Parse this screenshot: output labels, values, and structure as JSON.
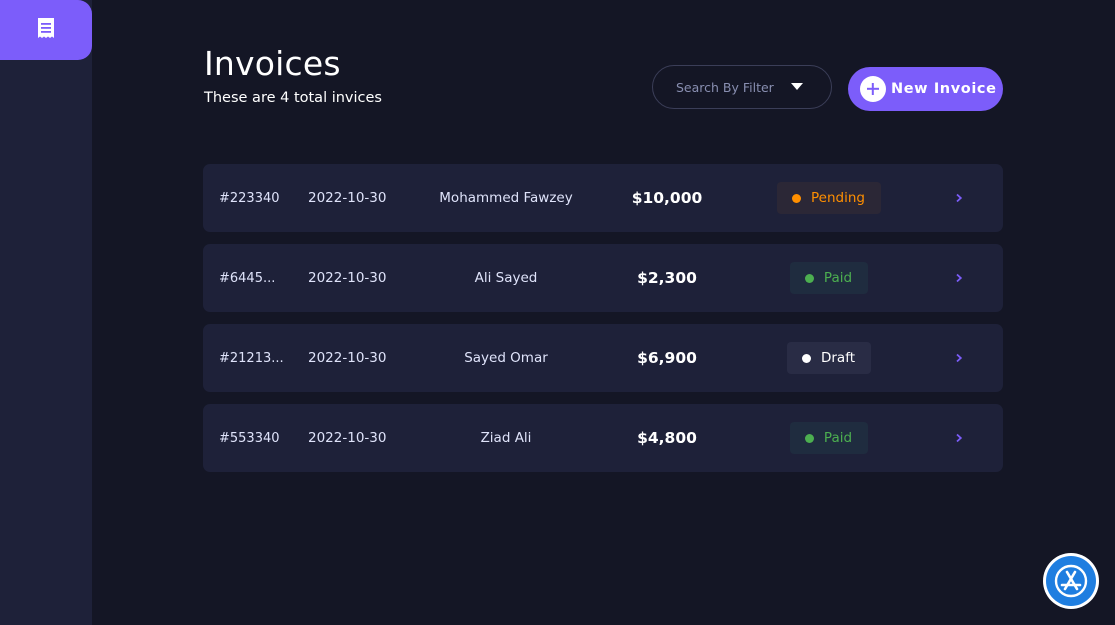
{
  "sidebar": {
    "logo_icon": "receipt-icon"
  },
  "header": {
    "title": "Invoices",
    "subtitle": "These are 4 total invices"
  },
  "filter": {
    "label": "Search By Filter",
    "icon": "caret-down-icon"
  },
  "new_invoice": {
    "label": "New Invoice",
    "icon": "plus-circle-icon"
  },
  "colors": {
    "accent": "#7c5dfa",
    "background": "#141625",
    "card": "#1e2139",
    "pending": "#ff8f00",
    "paid": "#4caf50",
    "draft": "#ffffff"
  },
  "invoices": [
    {
      "id": "#223340",
      "date": "2022-10-30",
      "name": "Mohammed Fawzey",
      "amount": "$10,000",
      "status": "Pending"
    },
    {
      "id": "#6445...",
      "date": "2022-10-30",
      "name": "Ali Sayed",
      "amount": "$2,300",
      "status": "Paid"
    },
    {
      "id": "#21213...",
      "date": "2022-10-30",
      "name": "Sayed Omar",
      "amount": "$6,900",
      "status": "Draft"
    },
    {
      "id": "#553340",
      "date": "2022-10-30",
      "name": "Ziad Ali",
      "amount": "$4,800",
      "status": "Paid"
    }
  ],
  "floating_button": {
    "icon": "app-store-icon"
  }
}
